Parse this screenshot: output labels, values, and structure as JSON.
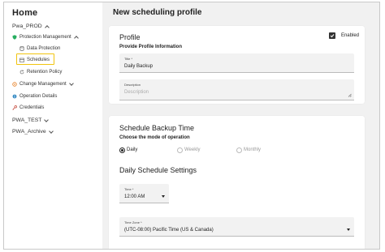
{
  "sidebar": {
    "home_title": "Home",
    "items": [
      {
        "label": "Pwa_PROD"
      },
      {
        "label": "Protection Management"
      },
      {
        "label": "Data Protection"
      },
      {
        "label": "Schedules"
      },
      {
        "label": "Retention Policy"
      },
      {
        "label": "Change Management"
      },
      {
        "label": "Operation Details"
      },
      {
        "label": "Credentials"
      },
      {
        "label": "PWA_TEST"
      },
      {
        "label": "PWA_Archive"
      }
    ],
    "highlight_color": "#f1c40f"
  },
  "main": {
    "page_title": "New scheduling profile",
    "profile": {
      "title": "Profile",
      "enabled_label": "Enabled",
      "enabled": true,
      "subtitle": "Provide Profile Information",
      "title_field": {
        "label": "Title *",
        "value": "Daily Backup"
      },
      "description_field": {
        "label": "Description",
        "placeholder": "Description"
      }
    },
    "schedule": {
      "title": "Schedule Backup Time",
      "subtitle": "Choose the mode of operation",
      "modes": [
        {
          "label": "Daily",
          "selected": true
        },
        {
          "label": "Weekly",
          "selected": false
        },
        {
          "label": "Monthly",
          "selected": false
        }
      ],
      "daily_title": "Daily Schedule Settings",
      "time_field": {
        "label": "Time *",
        "value": "12:00 AM"
      },
      "timezone_field": {
        "label": "Time Zone *",
        "value": "(UTC-08:00) Pacific Time (US & Canada)"
      }
    }
  }
}
